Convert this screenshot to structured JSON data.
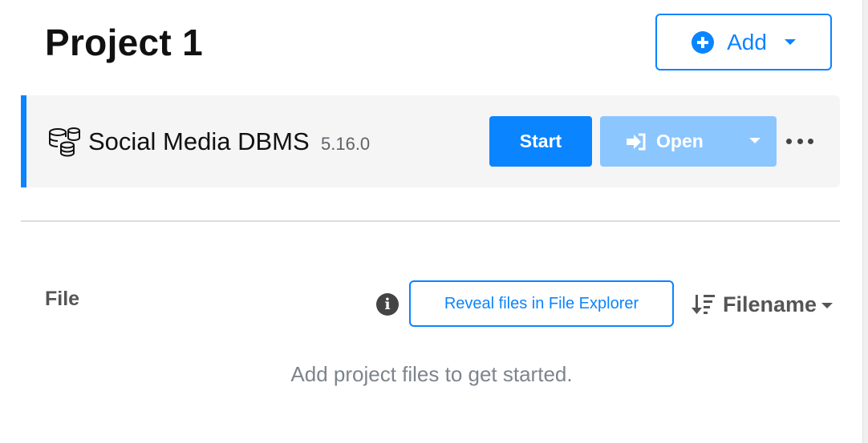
{
  "project": {
    "title": "Project 1",
    "add_label": "Add"
  },
  "dbms": {
    "name": "Social Media DBMS",
    "version": "5.16.0",
    "start_label": "Start",
    "open_label": "Open",
    "open_enabled": false
  },
  "files": {
    "heading": "File",
    "reveal_label": "Reveal files in File Explorer",
    "sort_label": "Filename",
    "empty_message": "Add project files to get started."
  },
  "icons": {
    "add": "plus-circle-icon",
    "dbms": "database-icon",
    "open": "sign-in-icon",
    "more": "ellipsis-icon",
    "info": "info-circle-icon",
    "sort": "sort-descending-icon"
  },
  "colors": {
    "accent": "#0a84ff",
    "accent_disabled": "#8cc6ff",
    "card_background": "#f5f5f5",
    "muted_text": "#7d848c"
  }
}
